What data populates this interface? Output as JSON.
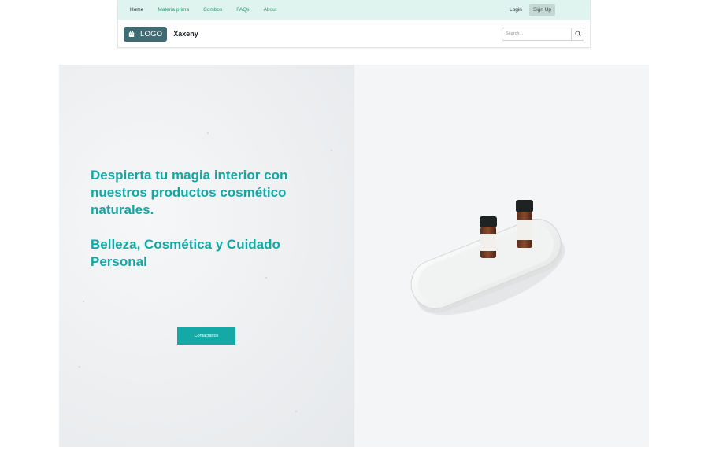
{
  "nav": {
    "links": [
      {
        "label": "Home"
      },
      {
        "label": "Materia prima"
      },
      {
        "label": "Combos"
      },
      {
        "label": "FAQs"
      },
      {
        "label": "About"
      }
    ],
    "login_label": "Login",
    "signup_label": "Sign Up"
  },
  "brand": {
    "logo_label": "LOGO",
    "name": "Xaxeny",
    "logo_icon": "shopping-bag-icon"
  },
  "search": {
    "placeholder": "Search...",
    "icon": "search-icon"
  },
  "hero": {
    "headline": "Despierta tu magia interior con nuestros productos cosmético naturales.",
    "subheadline": "Belleza, Cosmética y Cuidado Personal",
    "cta_label": "Contáctanos",
    "accent_color": "#13a7a4"
  }
}
